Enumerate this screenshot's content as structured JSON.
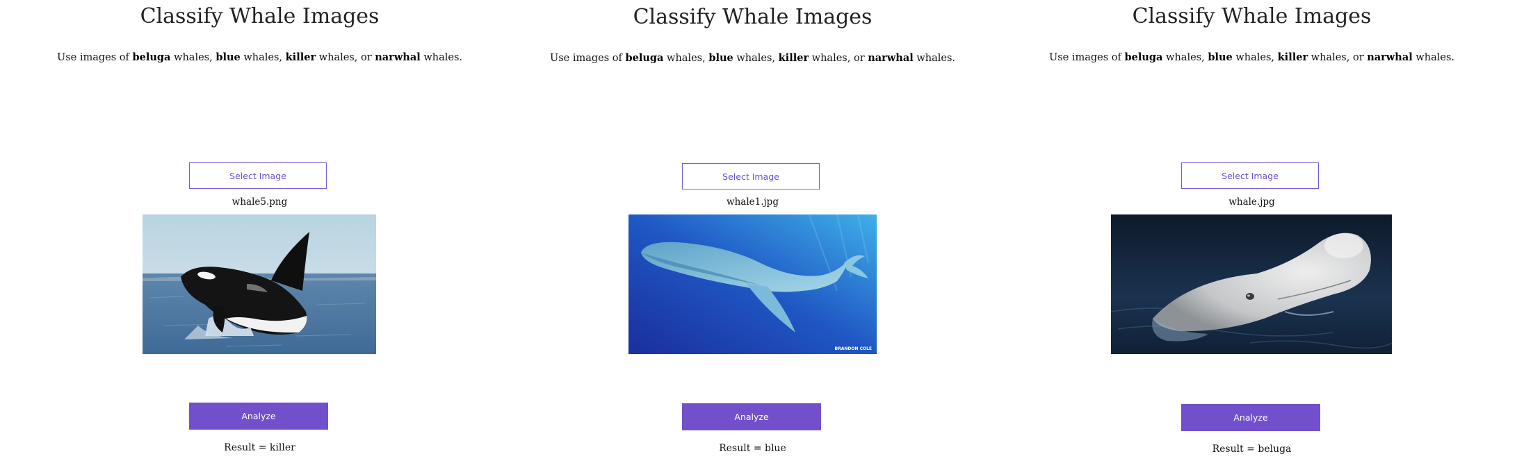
{
  "panels": [
    {
      "title": "Classify Whale Images",
      "description": {
        "prefix": "Use images of ",
        "kinds": [
          "beluga",
          "blue",
          "killer",
          "narwhal"
        ],
        "sep1": " whales, ",
        "sep2": " whales, ",
        "sep3": " whales, or ",
        "suffix": " whales."
      },
      "select_label": "Select Image",
      "filename": "whale5.png",
      "image_subject": "killer whale breaching",
      "analyze_label": "Analyze",
      "result": "Result = killer"
    },
    {
      "title": "Classify Whale Images",
      "description": {
        "prefix": "Use images of ",
        "kinds": [
          "beluga",
          "blue",
          "killer",
          "narwhal"
        ],
        "sep1": " whales, ",
        "sep2": " whales, ",
        "sep3": " whales, or ",
        "suffix": " whales."
      },
      "select_label": "Select Image",
      "filename": "whale1.jpg",
      "image_subject": "blue whale underwater",
      "image_watermark": "BRANDON COLE",
      "analyze_label": "Analyze",
      "result": "Result = blue"
    },
    {
      "title": "Classify Whale Images",
      "description": {
        "prefix": "Use images of ",
        "kinds": [
          "beluga",
          "blue",
          "killer",
          "narwhal"
        ],
        "sep1": " whales, ",
        "sep2": " whales, ",
        "sep3": " whales, or ",
        "suffix": " whales."
      },
      "select_label": "Select Image",
      "filename": "whale.jpg",
      "image_subject": "beluga whale surfacing",
      "analyze_label": "Analyze",
      "result": "Result = beluga"
    }
  ],
  "colors": {
    "accent": "#7250cc",
    "accent_border": "#7a5bd6",
    "text": "#222222"
  }
}
